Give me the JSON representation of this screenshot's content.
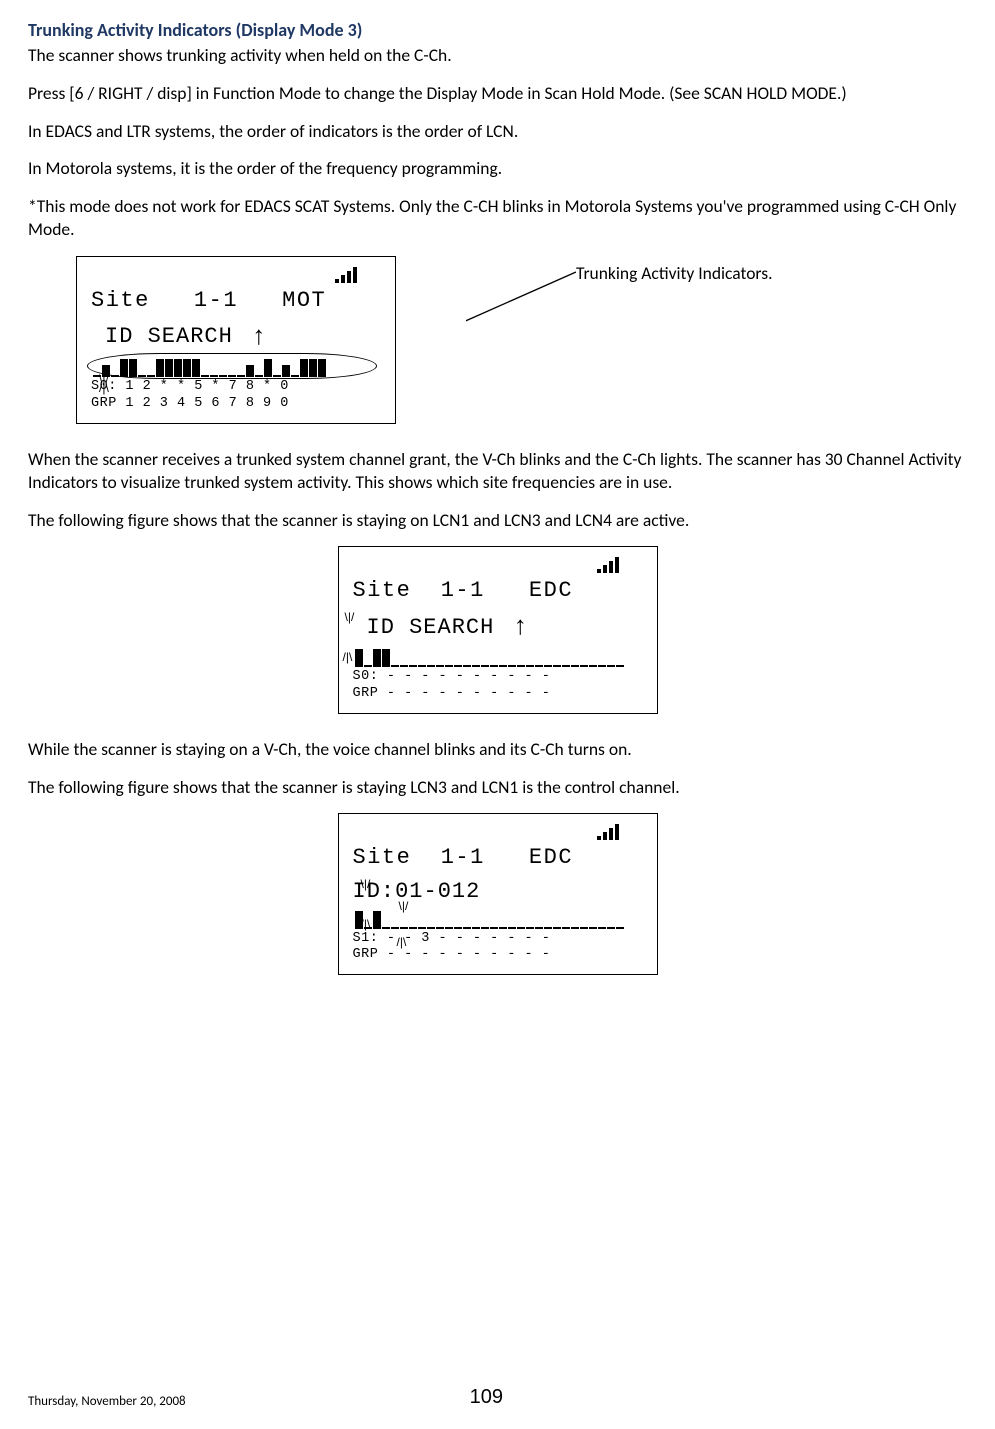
{
  "heading": "Trunking Activity Indicators (Display Mode 3)",
  "para1": "The scanner shows trunking activity when held on the C-Ch.",
  "para2": "Press [6 / RIGHT / disp] in Function Mode to change the Display Mode in Scan Hold Mode. (See SCAN HOLD MODE.)",
  "para3": "In EDACS and LTR systems, the order of indicators is the order of LCN.",
  "para4": "In Motorola systems, it is the order of the frequency programming.",
  "para5": "*This mode does not work for EDACS SCAT Systems. Only the C-CH blinks in Motorola Systems you've programmed using C-CH Only Mode.",
  "callout": "Trunking Activity Indicators.",
  "lcd1": {
    "line1": "Site   1-1   MOT",
    "line2": "ID SEARCH",
    "s_line": "S0: 1 2 * * 5 * 7 8 * 0",
    "grp_line": "GRP 1 2 3 4 5 6 7 8 9 0"
  },
  "para6": "When the scanner receives a trunked system channel grant, the V-Ch blinks and the C-Ch lights. The scanner has 30 Channel Activity Indicators to visualize trunked system activity. This shows which site frequencies are in use.",
  "para7": "The following figure shows that the scanner is staying on LCN1 and LCN3 and LCN4 are active.",
  "lcd2": {
    "line1": "Site  1-1   EDC",
    "line2": "ID SEARCH",
    "s_line": "S0: - - - - - - - - - -",
    "grp_line": "GRP - - - - - - - - - -"
  },
  "para8": "While the scanner is staying on a V-Ch, the voice channel blinks and its C-Ch turns on.",
  "para9": "The following figure shows that the scanner is staying LCN3 and LCN1 is the control channel.",
  "lcd3": {
    "line1": "Site  1-1   EDC",
    "line2": "ID:01-012",
    "s_line": "S1: - - 3 - - - - - - -",
    "grp_line": "GRP - - - - - - - - - -"
  },
  "footer_date": "Thursday, November 20, 2008",
  "page_number": "109"
}
